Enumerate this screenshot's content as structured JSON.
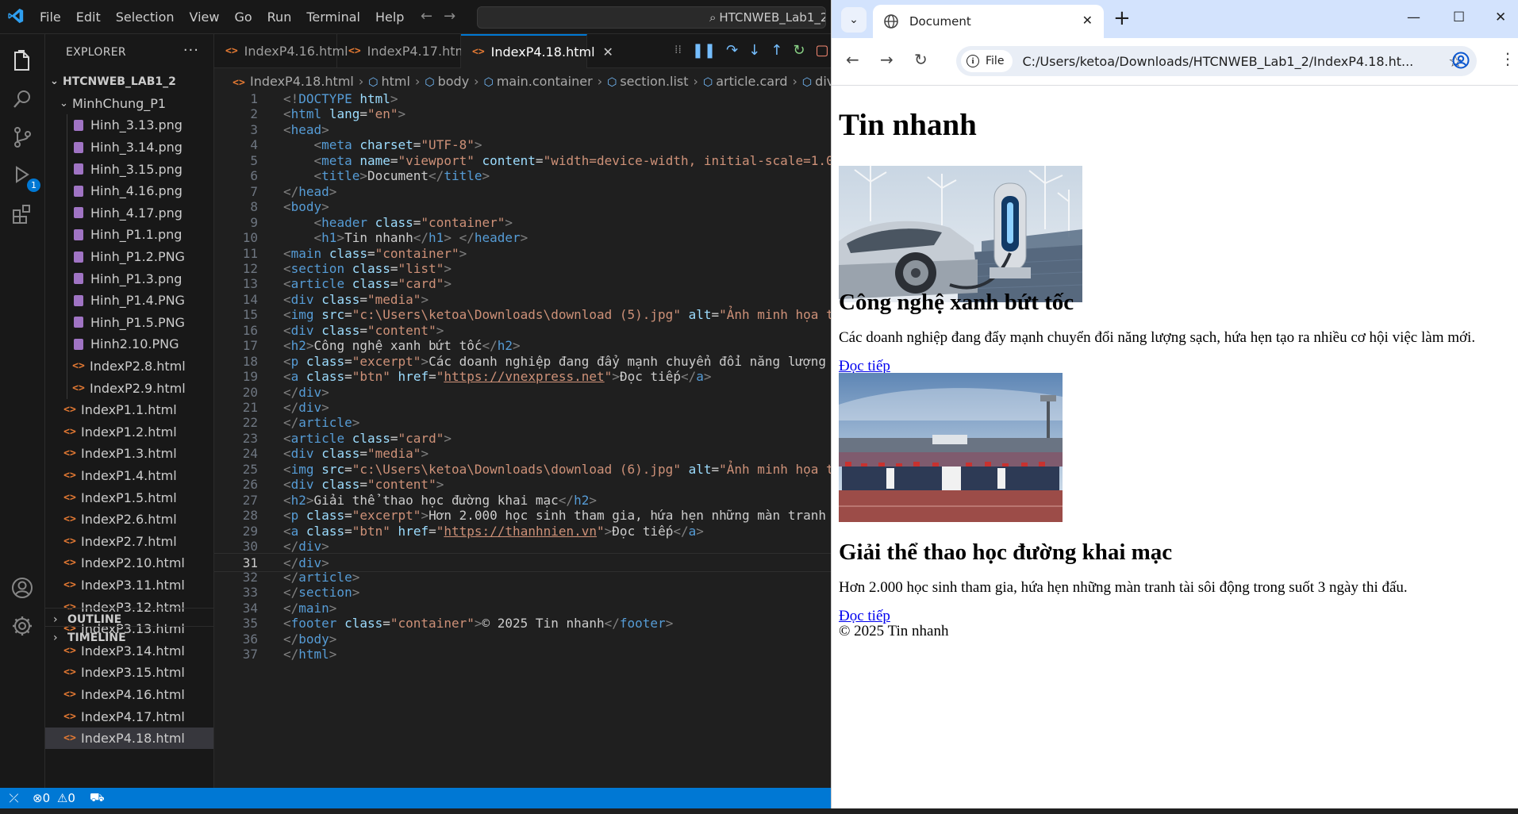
{
  "vscode": {
    "menu": [
      "File",
      "Edit",
      "Selection",
      "View",
      "Go",
      "Run",
      "Terminal",
      "Help"
    ],
    "search_text": "HTCNWEB_Lab1_2",
    "explorer": {
      "title": "EXPLORER",
      "root": "HTCNWEB_LAB1_2",
      "folder": "MinhChung_P1",
      "folder_files": [
        "Hinh_3.13.png",
        "Hinh_3.14.png",
        "Hinh_3.15.png",
        "Hinh_4.16.png",
        "Hinh_4.17.png",
        "Hinh_P1.1.png",
        "Hinh_P1.2.PNG",
        "Hinh_P1.3.png",
        "Hinh_P1.4.PNG",
        "Hinh_P1.5.PNG",
        "Hinh2.10.PNG",
        "IndexP2.8.html",
        "IndexP2.9.html"
      ],
      "root_files": [
        "IndexP1.1.html",
        "IndexP1.2.html",
        "IndexP1.3.html",
        "IndexP1.4.html",
        "IndexP1.5.html",
        "IndexP2.6.html",
        "IndexP2.7.html",
        "IndexP2.10.html",
        "IndexP3.11.html",
        "IndexP3.12.html",
        "IndexP3.13.html",
        "IndexP3.14.html",
        "IndexP3.15.html",
        "IndexP4.16.html",
        "IndexP4.17.html",
        "IndexP4.18.html"
      ],
      "selected": "IndexP4.18.html",
      "outline": "OUTLINE",
      "timeline": "TIMELINE"
    },
    "tabs": [
      {
        "label": "IndexP4.16.html",
        "active": false
      },
      {
        "label": "IndexP4.17.html",
        "active": false
      },
      {
        "label": "IndexP4.18.html",
        "active": true
      }
    ],
    "breadcrumb": [
      "IndexP4.18.html",
      "html",
      "body",
      "main.container",
      "section.list",
      "article.card",
      "div."
    ],
    "current_line": 31,
    "code": [
      [
        [
          "t",
          "<!"
        ],
        [
          "tn",
          "DOCTYPE"
        ],
        [
          "tx",
          " "
        ],
        [
          "an",
          "html"
        ],
        [
          "t",
          ">"
        ]
      ],
      [
        [
          "t",
          "<"
        ],
        [
          "tn",
          "html"
        ],
        [
          "tx",
          " "
        ],
        [
          "an",
          "lang"
        ],
        [
          "tx",
          "="
        ],
        [
          "av",
          "\"en\""
        ],
        [
          "t",
          ">"
        ]
      ],
      [
        [
          "t",
          "<"
        ],
        [
          "tn",
          "head"
        ],
        [
          "t",
          ">"
        ]
      ],
      [
        [
          "tx",
          "    "
        ],
        [
          "t",
          "<"
        ],
        [
          "tn",
          "meta"
        ],
        [
          "tx",
          " "
        ],
        [
          "an",
          "charset"
        ],
        [
          "tx",
          "="
        ],
        [
          "av",
          "\"UTF-8\""
        ],
        [
          "t",
          ">"
        ]
      ],
      [
        [
          "tx",
          "    "
        ],
        [
          "t",
          "<"
        ],
        [
          "tn",
          "meta"
        ],
        [
          "tx",
          " "
        ],
        [
          "an",
          "name"
        ],
        [
          "tx",
          "="
        ],
        [
          "av",
          "\"viewport\""
        ],
        [
          "tx",
          " "
        ],
        [
          "an",
          "content"
        ],
        [
          "tx",
          "="
        ],
        [
          "av",
          "\"width=device-width, initial-scale=1.0"
        ]
      ],
      [
        [
          "tx",
          "    "
        ],
        [
          "t",
          "<"
        ],
        [
          "tn",
          "title"
        ],
        [
          "t",
          ">"
        ],
        [
          "tx",
          "Document"
        ],
        [
          "t",
          "</"
        ],
        [
          "tn",
          "title"
        ],
        [
          "t",
          ">"
        ]
      ],
      [
        [
          "t",
          "</"
        ],
        [
          "tn",
          "head"
        ],
        [
          "t",
          ">"
        ]
      ],
      [
        [
          "t",
          "<"
        ],
        [
          "tn",
          "body"
        ],
        [
          "t",
          ">"
        ]
      ],
      [
        [
          "tx",
          "    "
        ],
        [
          "t",
          "<"
        ],
        [
          "tn",
          "header"
        ],
        [
          "tx",
          " "
        ],
        [
          "an",
          "class"
        ],
        [
          "tx",
          "="
        ],
        [
          "av",
          "\"container\""
        ],
        [
          "t",
          ">"
        ]
      ],
      [
        [
          "tx",
          "    "
        ],
        [
          "t",
          "<"
        ],
        [
          "tn",
          "h1"
        ],
        [
          "t",
          ">"
        ],
        [
          "tx",
          "Tin nhanh"
        ],
        [
          "t",
          "</"
        ],
        [
          "tn",
          "h1"
        ],
        [
          "t",
          ">"
        ],
        [
          "tx",
          " "
        ],
        [
          "t",
          "</"
        ],
        [
          "tn",
          "header"
        ],
        [
          "t",
          ">"
        ]
      ],
      [
        [
          "t",
          "<"
        ],
        [
          "tn",
          "main"
        ],
        [
          "tx",
          " "
        ],
        [
          "an",
          "class"
        ],
        [
          "tx",
          "="
        ],
        [
          "av",
          "\"container\""
        ],
        [
          "t",
          ">"
        ]
      ],
      [
        [
          "t",
          "<"
        ],
        [
          "tn",
          "section"
        ],
        [
          "tx",
          " "
        ],
        [
          "an",
          "class"
        ],
        [
          "tx",
          "="
        ],
        [
          "av",
          "\"list\""
        ],
        [
          "t",
          ">"
        ]
      ],
      [
        [
          "t",
          "<"
        ],
        [
          "tn",
          "article"
        ],
        [
          "tx",
          " "
        ],
        [
          "an",
          "class"
        ],
        [
          "tx",
          "="
        ],
        [
          "av",
          "\"card\""
        ],
        [
          "t",
          ">"
        ]
      ],
      [
        [
          "t",
          "<"
        ],
        [
          "tn",
          "div"
        ],
        [
          "tx",
          " "
        ],
        [
          "an",
          "class"
        ],
        [
          "tx",
          "="
        ],
        [
          "av",
          "\"media\""
        ],
        [
          "t",
          ">"
        ]
      ],
      [
        [
          "t",
          "<"
        ],
        [
          "tn",
          "img"
        ],
        [
          "tx",
          " "
        ],
        [
          "an",
          "src"
        ],
        [
          "tx",
          "="
        ],
        [
          "av",
          "\"c:\\Users\\ketoa\\Downloads\\download (5).jpg\""
        ],
        [
          "tx",
          " "
        ],
        [
          "an",
          "alt"
        ],
        [
          "tx",
          "="
        ],
        [
          "av",
          "\"Ảnh minh họa t"
        ]
      ],
      [
        [
          "t",
          "<"
        ],
        [
          "tn",
          "div"
        ],
        [
          "tx",
          " "
        ],
        [
          "an",
          "class"
        ],
        [
          "tx",
          "="
        ],
        [
          "av",
          "\"content\""
        ],
        [
          "t",
          ">"
        ]
      ],
      [
        [
          "t",
          "<"
        ],
        [
          "tn",
          "h2"
        ],
        [
          "t",
          ">"
        ],
        [
          "tx",
          "Công nghệ xanh bứt tốc"
        ],
        [
          "t",
          "</"
        ],
        [
          "tn",
          "h2"
        ],
        [
          "t",
          ">"
        ]
      ],
      [
        [
          "t",
          "<"
        ],
        [
          "tn",
          "p"
        ],
        [
          "tx",
          " "
        ],
        [
          "an",
          "class"
        ],
        [
          "tx",
          "="
        ],
        [
          "av",
          "\"excerpt\""
        ],
        [
          "t",
          ">"
        ],
        [
          "tx",
          "Các doanh nghiệp đang đẩy mạnh chuyển đổi năng lượng"
        ]
      ],
      [
        [
          "t",
          "<"
        ],
        [
          "tn",
          "a"
        ],
        [
          "tx",
          " "
        ],
        [
          "an",
          "class"
        ],
        [
          "tx",
          "="
        ],
        [
          "av",
          "\"btn\""
        ],
        [
          "tx",
          " "
        ],
        [
          "an",
          "href"
        ],
        [
          "tx",
          "="
        ],
        [
          "av",
          "\""
        ],
        [
          "lk",
          "https://vnexpress.net"
        ],
        [
          "av",
          "\""
        ],
        [
          "t",
          ">"
        ],
        [
          "tx",
          "Đọc tiếp"
        ],
        [
          "t",
          "</"
        ],
        [
          "tn",
          "a"
        ],
        [
          "t",
          ">"
        ]
      ],
      [
        [
          "t",
          "</"
        ],
        [
          "tn",
          "div"
        ],
        [
          "t",
          ">"
        ]
      ],
      [
        [
          "t",
          "</"
        ],
        [
          "tn",
          "div"
        ],
        [
          "t",
          ">"
        ]
      ],
      [
        [
          "t",
          "</"
        ],
        [
          "tn",
          "article"
        ],
        [
          "t",
          ">"
        ]
      ],
      [
        [
          "t",
          "<"
        ],
        [
          "tn",
          "article"
        ],
        [
          "tx",
          " "
        ],
        [
          "an",
          "class"
        ],
        [
          "tx",
          "="
        ],
        [
          "av",
          "\"card\""
        ],
        [
          "t",
          ">"
        ]
      ],
      [
        [
          "t",
          "<"
        ],
        [
          "tn",
          "div"
        ],
        [
          "tx",
          " "
        ],
        [
          "an",
          "class"
        ],
        [
          "tx",
          "="
        ],
        [
          "av",
          "\"media\""
        ],
        [
          "t",
          ">"
        ]
      ],
      [
        [
          "t",
          "<"
        ],
        [
          "tn",
          "img"
        ],
        [
          "tx",
          " "
        ],
        [
          "an",
          "src"
        ],
        [
          "tx",
          "="
        ],
        [
          "av",
          "\"c:\\Users\\ketoa\\Downloads\\download (6).jpg\""
        ],
        [
          "tx",
          " "
        ],
        [
          "an",
          "alt"
        ],
        [
          "tx",
          "="
        ],
        [
          "av",
          "\"Ảnh minh họa t"
        ]
      ],
      [
        [
          "t",
          "<"
        ],
        [
          "tn",
          "div"
        ],
        [
          "tx",
          " "
        ],
        [
          "an",
          "class"
        ],
        [
          "tx",
          "="
        ],
        [
          "av",
          "\"content\""
        ],
        [
          "t",
          ">"
        ]
      ],
      [
        [
          "t",
          "<"
        ],
        [
          "tn",
          "h2"
        ],
        [
          "t",
          ">"
        ],
        [
          "tx",
          "Giải thể thao học đường khai mạc"
        ],
        [
          "t",
          "</"
        ],
        [
          "tn",
          "h2"
        ],
        [
          "t",
          ">"
        ]
      ],
      [
        [
          "t",
          "<"
        ],
        [
          "tn",
          "p"
        ],
        [
          "tx",
          " "
        ],
        [
          "an",
          "class"
        ],
        [
          "tx",
          "="
        ],
        [
          "av",
          "\"excerpt\""
        ],
        [
          "t",
          ">"
        ],
        [
          "tx",
          "Hơn 2.000 học sinh tham gia, hứa hẹn những màn tranh"
        ]
      ],
      [
        [
          "t",
          "<"
        ],
        [
          "tn",
          "a"
        ],
        [
          "tx",
          " "
        ],
        [
          "an",
          "class"
        ],
        [
          "tx",
          "="
        ],
        [
          "av",
          "\"btn\""
        ],
        [
          "tx",
          " "
        ],
        [
          "an",
          "href"
        ],
        [
          "tx",
          "="
        ],
        [
          "av",
          "\""
        ],
        [
          "lk",
          "https://thanhnien.vn"
        ],
        [
          "av",
          "\""
        ],
        [
          "t",
          ">"
        ],
        [
          "tx",
          "Đọc tiếp"
        ],
        [
          "t",
          "</"
        ],
        [
          "tn",
          "a"
        ],
        [
          "t",
          ">"
        ]
      ],
      [
        [
          "t",
          "</"
        ],
        [
          "tn",
          "div"
        ],
        [
          "t",
          ">"
        ]
      ],
      [
        [
          "t",
          "</"
        ],
        [
          "tn",
          "div"
        ],
        [
          "t",
          ">"
        ]
      ],
      [
        [
          "t",
          "</"
        ],
        [
          "tn",
          "article"
        ],
        [
          "t",
          ">"
        ]
      ],
      [
        [
          "t",
          "</"
        ],
        [
          "tn",
          "section"
        ],
        [
          "t",
          ">"
        ]
      ],
      [
        [
          "t",
          "</"
        ],
        [
          "tn",
          "main"
        ],
        [
          "t",
          ">"
        ]
      ],
      [
        [
          "t",
          "<"
        ],
        [
          "tn",
          "footer"
        ],
        [
          "tx",
          " "
        ],
        [
          "an",
          "class"
        ],
        [
          "tx",
          "="
        ],
        [
          "av",
          "\"container\""
        ],
        [
          "t",
          ">"
        ],
        [
          "tx",
          "© 2025 Tin nhanh"
        ],
        [
          "t",
          "</"
        ],
        [
          "tn",
          "footer"
        ],
        [
          "t",
          ">"
        ]
      ],
      [
        [
          "t",
          "</"
        ],
        [
          "tn",
          "body"
        ],
        [
          "t",
          ">"
        ]
      ],
      [
        [
          "t",
          "</"
        ],
        [
          "tn",
          "html"
        ],
        [
          "t",
          ">"
        ]
      ]
    ],
    "status": {
      "errors": "0",
      "warnings": "0"
    }
  },
  "chrome": {
    "tab_title": "Document",
    "omnibox_chip": "File",
    "url": "C:/Users/ketoa/Downloads/HTCNWEB_Lab1_2/IndexP4.18.ht...",
    "page": {
      "h1": "Tin nhanh",
      "articles": [
        {
          "title": "Công nghệ xanh bứt tốc",
          "excerpt": "Các doanh nghiệp đang đẩy mạnh chuyển đổi năng lượng sạch, hứa hẹn tạo ra nhiều cơ hội việc làm mới.",
          "link": "Đọc tiếp"
        },
        {
          "title": "Giải thể thao học đường khai mạc",
          "excerpt": "Hơn 2.000 học sinh tham gia, hứa hẹn những màn tranh tài sôi động trong suốt 3 ngày thi đấu.",
          "link": "Đọc tiếp"
        }
      ],
      "footer": "© 2025 Tin nhanh"
    }
  },
  "colors": {
    "vscode_accent": "#0078d4",
    "chrome_frame": "#d3e3fd",
    "link": "#0000ee"
  }
}
